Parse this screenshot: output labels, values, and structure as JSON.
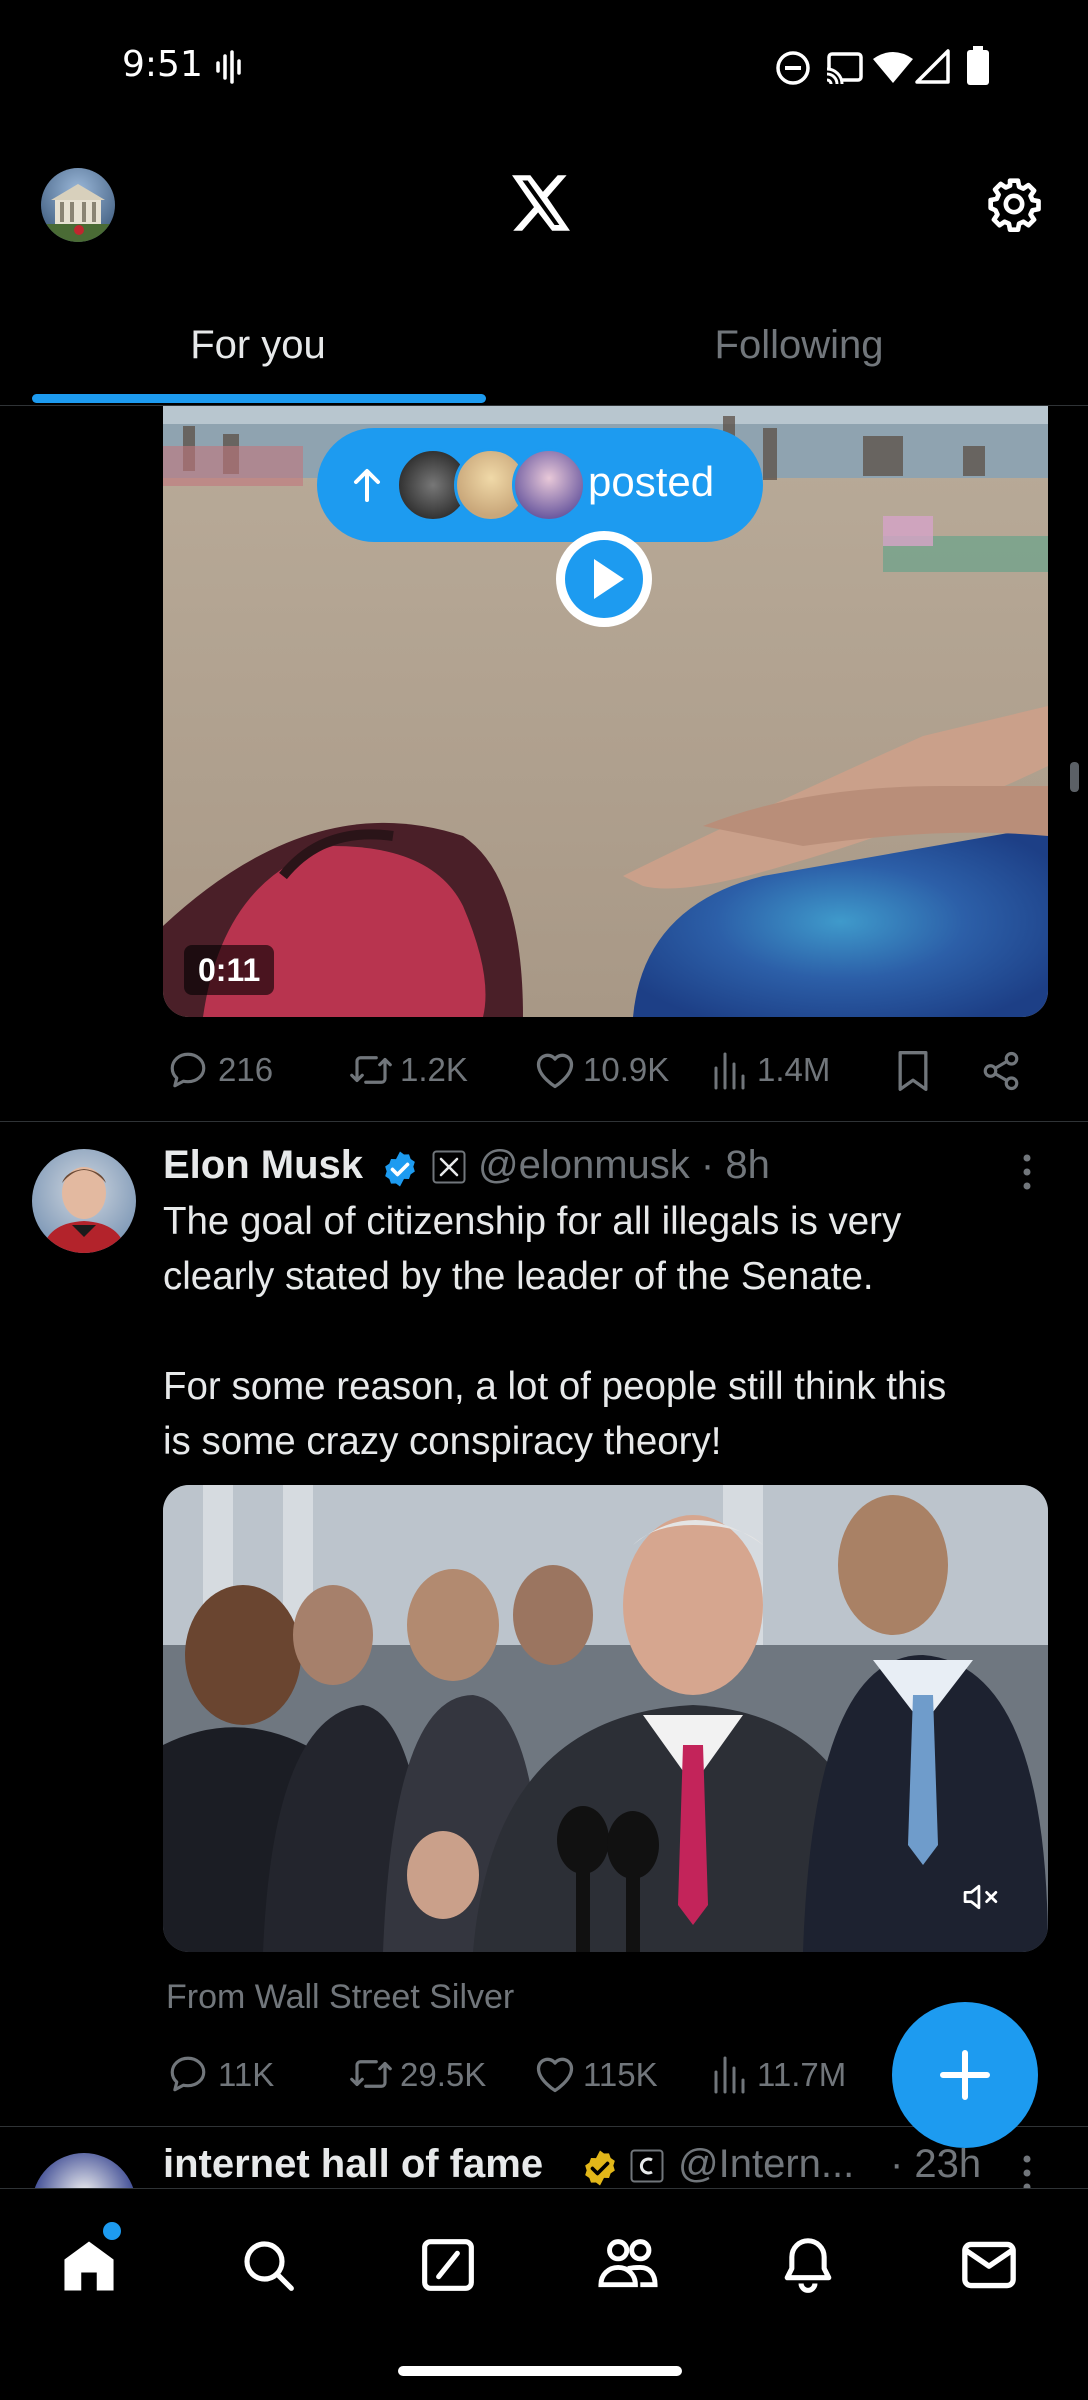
{
  "status_bar": {
    "time": "9:51"
  },
  "header": {
    "logo": "X"
  },
  "tabs": [
    {
      "label": "For you",
      "selected": true
    },
    {
      "label": "Following",
      "selected": false
    }
  ],
  "new_posts_pill": {
    "label": "posted"
  },
  "first_post": {
    "video_duration": "0:11",
    "actions": {
      "replies": "216",
      "reposts": "1.2K",
      "likes": "10.9K",
      "views": "1.4M"
    }
  },
  "second_post": {
    "author_name": "Elon Musk",
    "handle": "@elonmusk",
    "time": "8h",
    "text_line1": "The goal of citizenship for all illegals is very",
    "text_line2": "clearly stated by the leader of the Senate.",
    "text_line3": "For some reason, a lot of people still think this",
    "text_line4": "is some crazy conspiracy theory!",
    "source": "From Wall Street Silver",
    "actions": {
      "replies": "11K",
      "reposts": "29.5K",
      "likes": "115K",
      "views": "11.7M"
    }
  },
  "third_post": {
    "author_name": "internet hall of fame",
    "handle": "@Intern...",
    "time": "· 23h"
  },
  "colors": {
    "accent": "#1d9bf0",
    "background": "#000000",
    "muted": "#71767b",
    "text": "#e7e9ea",
    "gold_badge": "#e2b719"
  },
  "icons": [
    "home-icon",
    "search-icon",
    "grok-icon",
    "communities-icon",
    "notifications-icon",
    "messages-icon",
    "settings-icon",
    "share-icon",
    "bookmark-icon",
    "mute-icon",
    "play-icon"
  ]
}
